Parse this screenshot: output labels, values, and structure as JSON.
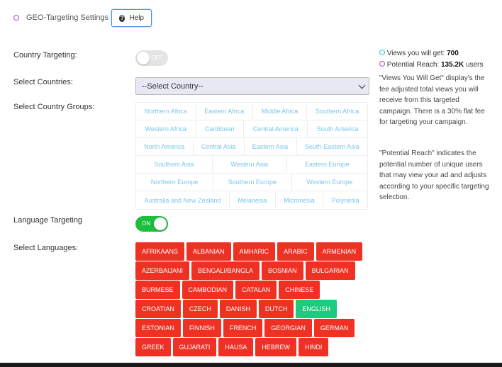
{
  "header": {
    "title": "GEO-Targeting Settings",
    "help_label": "Help"
  },
  "country_targeting": {
    "label": "Country Targeting:",
    "toggle_text": "OFF",
    "state": "off"
  },
  "select_countries": {
    "label": "Select Countries:",
    "value": "--Select Country--"
  },
  "country_groups": {
    "label": "Select Country Groups:",
    "rows": [
      [
        "Northern Africa",
        "Eastern Africa",
        "Middle Africa",
        "Southern Africa"
      ],
      [
        "Western Africa",
        "Caribbean",
        "Central America",
        "South America"
      ],
      [
        "North America",
        "Central Asia",
        "Eastern Asia",
        "South-Eastern Asia"
      ],
      [
        "Southern Asia",
        "Western Asia",
        "Eastern Europe"
      ],
      [
        "Northern Europe",
        "Southern Europe",
        "Western Europe"
      ],
      [
        "Australia and New Zealand",
        "Melanesia",
        "Micronesia",
        "Polynesia"
      ]
    ]
  },
  "side_panel": {
    "views_label": "Views you will get:",
    "views_value": "700",
    "reach_label": "Potential Reach:",
    "reach_value": "135.2K",
    "reach_unit": "users",
    "views_desc": "\"Views You Will Get\" display's the fee adjusted total views you will receive from this targeted campaign. There is a 30% flat fee for targeting your campaign.",
    "reach_desc": "\"Potential Reach\" indicates the potential number of unique users that may view your ad and adjusts according to your specific targeting selection."
  },
  "language_targeting": {
    "label": "Language Targeting",
    "toggle_text": "ON",
    "state": "on"
  },
  "languages": {
    "label": "Select Languages:",
    "selected": "ENGLISH",
    "rows": [
      [
        "AFRIKAANS",
        "ALBANIAN",
        "AMHARIC",
        "ARABIC",
        "ARMENIAN"
      ],
      [
        "AZERBAIJANI",
        "BENGALI/BANGLA",
        "BOSNIAN",
        "BULGARIAN"
      ],
      [
        "BURMESE",
        "CAMBODIAN",
        "CATALAN",
        "CHINESE"
      ],
      [
        "CROATIAN",
        "CZECH",
        "DANISH",
        "DUTCH",
        "ENGLISH"
      ],
      [
        "ESTONIAN",
        "FINNISH",
        "FRENCH",
        "GEORGIAN",
        "GERMAN"
      ],
      [
        "GREEK",
        "GUJARATI",
        "HAUSA",
        "HEBREW",
        "HINDI"
      ]
    ]
  },
  "colors": {
    "accent_red": "#ef3124",
    "selected_green": "#1dca7e",
    "toggle_on": "#1bbf3c",
    "group_text": "#7cc6ec"
  },
  "icons": {
    "help": "question-circle-icon",
    "header_marker": "circle-outline-icon"
  }
}
